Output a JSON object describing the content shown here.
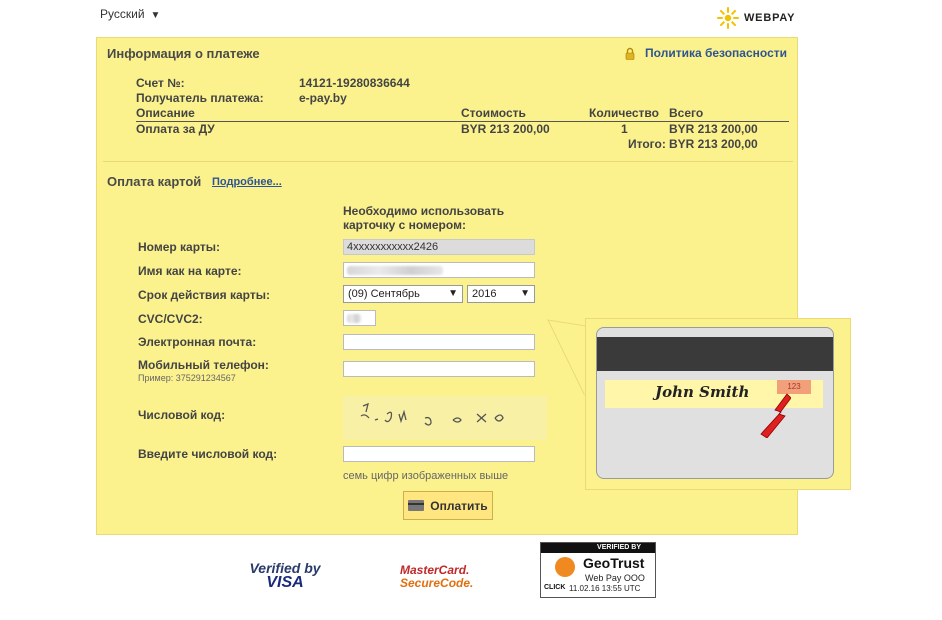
{
  "header": {
    "language": "Русский",
    "logo_text": "WEBPAY"
  },
  "payment_info": {
    "title": "Информация о платеже",
    "privacy_link": "Политика безопасности",
    "invoice_label": "Счет №:",
    "invoice_value": "14121-19280836644",
    "recipient_label": "Получатель платежа:",
    "recipient_value": "e-pay.by",
    "table": {
      "headers": [
        "Описание",
        "Стоимость",
        "Количество",
        "Всего"
      ],
      "rows": [
        [
          "Оплата за ДУ",
          "BYR 213 200,00",
          "1",
          "BYR 213 200,00"
        ]
      ],
      "total_label": "Итого:",
      "total_value": "BYR 213 200,00"
    }
  },
  "card_payment": {
    "title": "Оплата картой",
    "more_link": "Подробнее...",
    "notice": "Необходимо использовать карточку с номером:",
    "fields": {
      "card_number_label": "Номер карты:",
      "card_number_value": "4xxxxxxxxxxx2426",
      "name_label": "Имя как на карте:",
      "expiry_label": "Срок действия карты:",
      "expiry_month": "(09) Сентябрь",
      "expiry_year": "2016",
      "cvc_label": "CVC/CVC2:",
      "email_label": "Электронная почта:",
      "phone_label": "Мобильный телефон:",
      "phone_hint": "Пример: 375291234567",
      "captcha_label": "Числовой код:",
      "code_input_label": "Введите числовой код:",
      "captcha_caption": "семь цифр изображенных выше"
    },
    "pay_button": "Оплатить"
  },
  "card_illustration": {
    "holder_name": "John Smith",
    "cvv": "123"
  },
  "badges": {
    "visa_line1": "Verified by",
    "visa_line2": "VISA",
    "mc_line1": "MasterCard.",
    "mc_line2": "SecureCode.",
    "geotrust_top": "VERIFIED BY",
    "geotrust_brand": "GeoTrust",
    "geotrust_company": "Web Pay OOO",
    "geotrust_click": "CLICK",
    "geotrust_stamp": "11.02.16 13:55 UTC"
  },
  "colors": {
    "panel_bg": "#fbf28e",
    "link": "#2e5590",
    "accent_arrow": "#e02020"
  },
  "icons": [
    "lock-icon",
    "webpay-sun-icon",
    "card-icon",
    "arrow-icon"
  ]
}
